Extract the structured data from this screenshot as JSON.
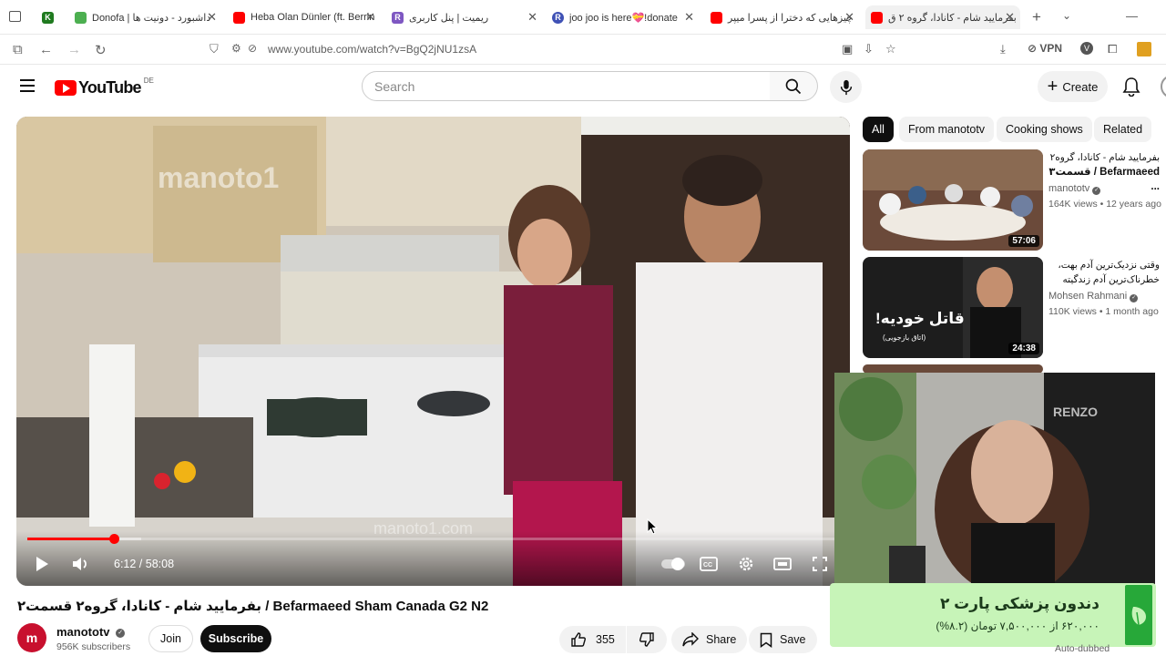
{
  "browser": {
    "tabs": [
      {
        "label": "",
        "favicon_color": "#2e7d32",
        "active": false
      },
      {
        "label": "داشبورد - دونیت ها | Donofa",
        "favicon_color": "#4caf50",
        "active": false
      },
      {
        "label": "Heba Olan Dünler (ft. Berrin",
        "favicon_color": "#ff0000",
        "active": false
      },
      {
        "label": "ریمیت | پنل کاربری",
        "favicon_color": "#7e57c2",
        "active": false
      },
      {
        "label": "joo joo is here💝!donate",
        "favicon_color": "#3f51b5",
        "active": false
      },
      {
        "label": "چیزهایی که دخترا از پسرا میپر",
        "favicon_color": "#ff0000",
        "active": false
      },
      {
        "label": "بفرمایید شام - کانادا، گروه ۲ ق",
        "favicon_color": "#ff0000",
        "active": true
      }
    ],
    "url": "www.youtube.com/watch?v=BgQ2jNU1zsA",
    "vpn_label": "VPN"
  },
  "header": {
    "logo_text": "YouTube",
    "country_code": "DE",
    "search_placeholder": "Search",
    "create_label": "Create"
  },
  "player": {
    "time_label": "6:12 / 58:08",
    "progress_fraction": 0.107,
    "buffered_fraction": 0.14,
    "watermark": "manoto1",
    "watermark_bottom": "manoto1.com"
  },
  "video": {
    "title": "بفرمایید شام - کانادا، گروه۲ قسمت۲ / Befarmaeed Sham Canada G2 N2",
    "channel": "manototv",
    "subscribers": "956K subscribers",
    "join_label": "Join",
    "subscribe_label": "Subscribe",
    "likes": "355",
    "share_label": "Share",
    "save_label": "Save"
  },
  "chips": [
    {
      "label": "All",
      "active": true
    },
    {
      "label": "From manototv",
      "active": false
    },
    {
      "label": "Cooking shows",
      "active": false
    },
    {
      "label": "Related",
      "active": false
    }
  ],
  "sidebar": {
    "items": [
      {
        "title_line1": "بفرمایید شام - کانادا، گروه۲",
        "title_line2": "Befarmaeed / قسمت۳ ...",
        "channel": "manototv",
        "verified": true,
        "meta": "164K views • 12 years ago",
        "duration": "57:06"
      },
      {
        "title_line1": "وقتی نزدیک‌ترین آدم بهت،",
        "title_line2": "خطرناک‌ترین آدم زندگیته",
        "channel": "Mohsen Rahmani",
        "verified": true,
        "meta": "110K views • 1 month ago",
        "duration": "24:38",
        "thumb_text": "قاتل خودیه!",
        "thumb_subtext": "(اتاق بازجویی)"
      }
    ],
    "auto_dubbed": "Auto-dubbed"
  },
  "promo": {
    "title": "دندون پزشکی پارت ۲",
    "subtitle": "۶۲۰,۰۰۰ از ۷,۵۰۰,۰۰۰ تومان (۸.۲%)"
  },
  "colors": {
    "youtube_red": "#ff0000",
    "promo_bg": "#c7f4b8",
    "promo_accent": "#27a839"
  }
}
